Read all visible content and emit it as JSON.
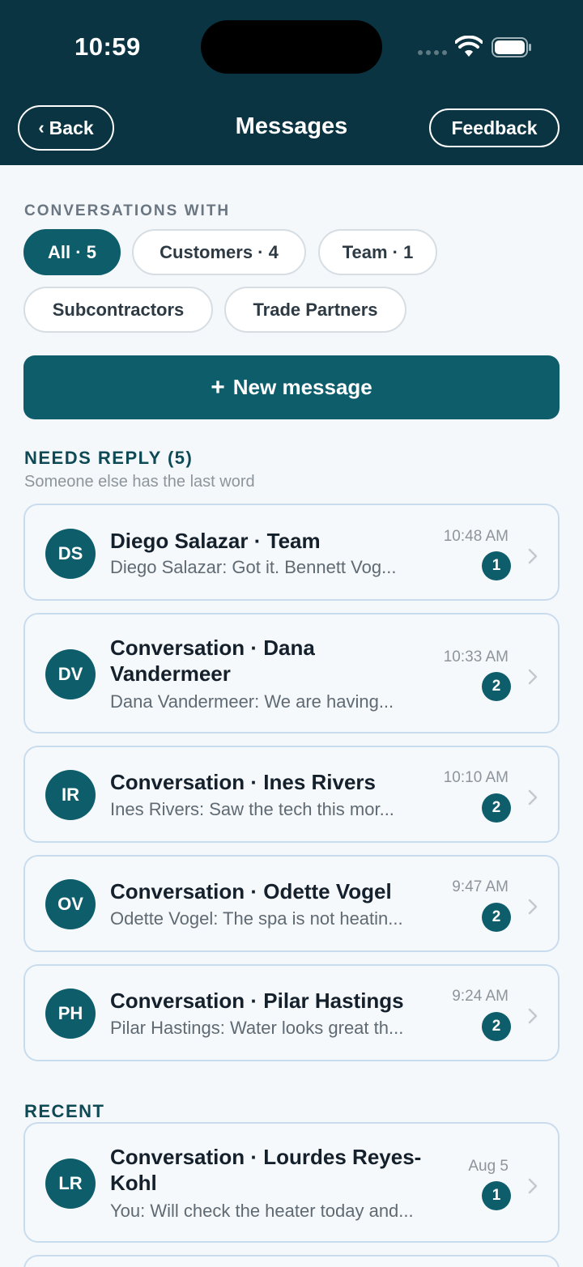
{
  "status_bar": {
    "time": "10:59"
  },
  "header": {
    "back_label": "Back",
    "title": "Messages",
    "feedback_label": "Feedback"
  },
  "filters": {
    "label": "CONVERSATIONS WITH",
    "chips": [
      {
        "label": "All · 5",
        "active": true
      },
      {
        "label": "Customers · 4",
        "active": false
      },
      {
        "label": "Team · 1",
        "active": false
      },
      {
        "label": "Subcontractors",
        "active": false
      },
      {
        "label": "Trade Partners",
        "active": false
      }
    ]
  },
  "new_message_label": "New message",
  "needs_reply": {
    "title": "NEEDS REPLY (5)",
    "subtitle": "Someone else has the last word",
    "items": [
      {
        "initials": "DS",
        "title": "Diego Salazar · Team",
        "preview": "Diego Salazar: Got it. Bennett Vog...",
        "time": "10:48 AM",
        "unread": "1"
      },
      {
        "initials": "DV",
        "title": "Conversation · Dana Vandermeer",
        "preview": "Dana Vandermeer: We are having...",
        "time": "10:33 AM",
        "unread": "2"
      },
      {
        "initials": "IR",
        "title": "Conversation · Ines Rivers",
        "preview": "Ines Rivers: Saw the tech this mor...",
        "time": "10:10 AM",
        "unread": "2"
      },
      {
        "initials": "OV",
        "title": "Conversation · Odette Vogel",
        "preview": "Odette Vogel: The spa is not heatin...",
        "time": "9:47 AM",
        "unread": "2"
      },
      {
        "initials": "PH",
        "title": "Conversation · Pilar Hastings",
        "preview": "Pilar Hastings: Water looks great th...",
        "time": "9:24 AM",
        "unread": "2"
      }
    ]
  },
  "recent": {
    "title": "RECENT",
    "items": [
      {
        "initials": "LR",
        "title": "Conversation · Lourdes Reyes-Kohl",
        "preview": "You: Will check the heater today and...",
        "time": "Aug 5",
        "unread": "1"
      }
    ]
  },
  "colors": {
    "header_bg": "#0a3441",
    "accent": "#0e5d6b",
    "card_border": "#c9dcee",
    "page_bg": "#f5f8fb"
  },
  "icons": [
    "chevron-left-icon",
    "wifi-icon",
    "battery-icon",
    "plus-icon",
    "chevron-right-icon"
  ]
}
